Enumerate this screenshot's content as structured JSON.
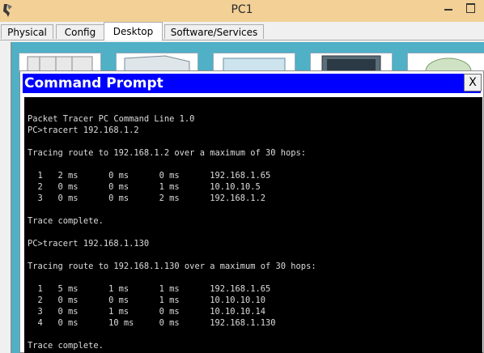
{
  "window": {
    "title": "PC1",
    "icon": "packet-tracer-pc-icon"
  },
  "tabs": [
    {
      "label": "Physical",
      "active": false
    },
    {
      "label": "Config",
      "active": false
    },
    {
      "label": "Desktop",
      "active": true
    },
    {
      "label": "Software/Services",
      "active": false
    }
  ],
  "desktop": {
    "background_color": "#4fb0c6"
  },
  "command_prompt": {
    "title": "Command Prompt",
    "close_label": "X",
    "lines": [
      "Packet Tracer PC Command Line 1.0",
      "PC>tracert 192.168.1.2",
      "",
      "Tracing route to 192.168.1.2 over a maximum of 30 hops:",
      "",
      "  1   2 ms      0 ms      0 ms      192.168.1.65",
      "  2   0 ms      0 ms      1 ms      10.10.10.5",
      "  3   0 ms      0 ms      2 ms      192.168.1.2",
      "",
      "Trace complete.",
      "",
      "PC>tracert 192.168.1.130",
      "",
      "Tracing route to 192.168.1.130 over a maximum of 30 hops:",
      "",
      "  1   5 ms      1 ms      1 ms      192.168.1.65",
      "  2   0 ms      0 ms      1 ms      10.10.10.10",
      "  3   0 ms      1 ms      0 ms      10.10.10.14",
      "  4   0 ms      10 ms     0 ms      192.168.1.130",
      "",
      "Trace complete."
    ]
  },
  "colors": {
    "titlebar": "#f2d096",
    "cmd_title_bar": "#0000ff",
    "terminal_bg": "#000000",
    "terminal_text": "#dcdcdc"
  }
}
